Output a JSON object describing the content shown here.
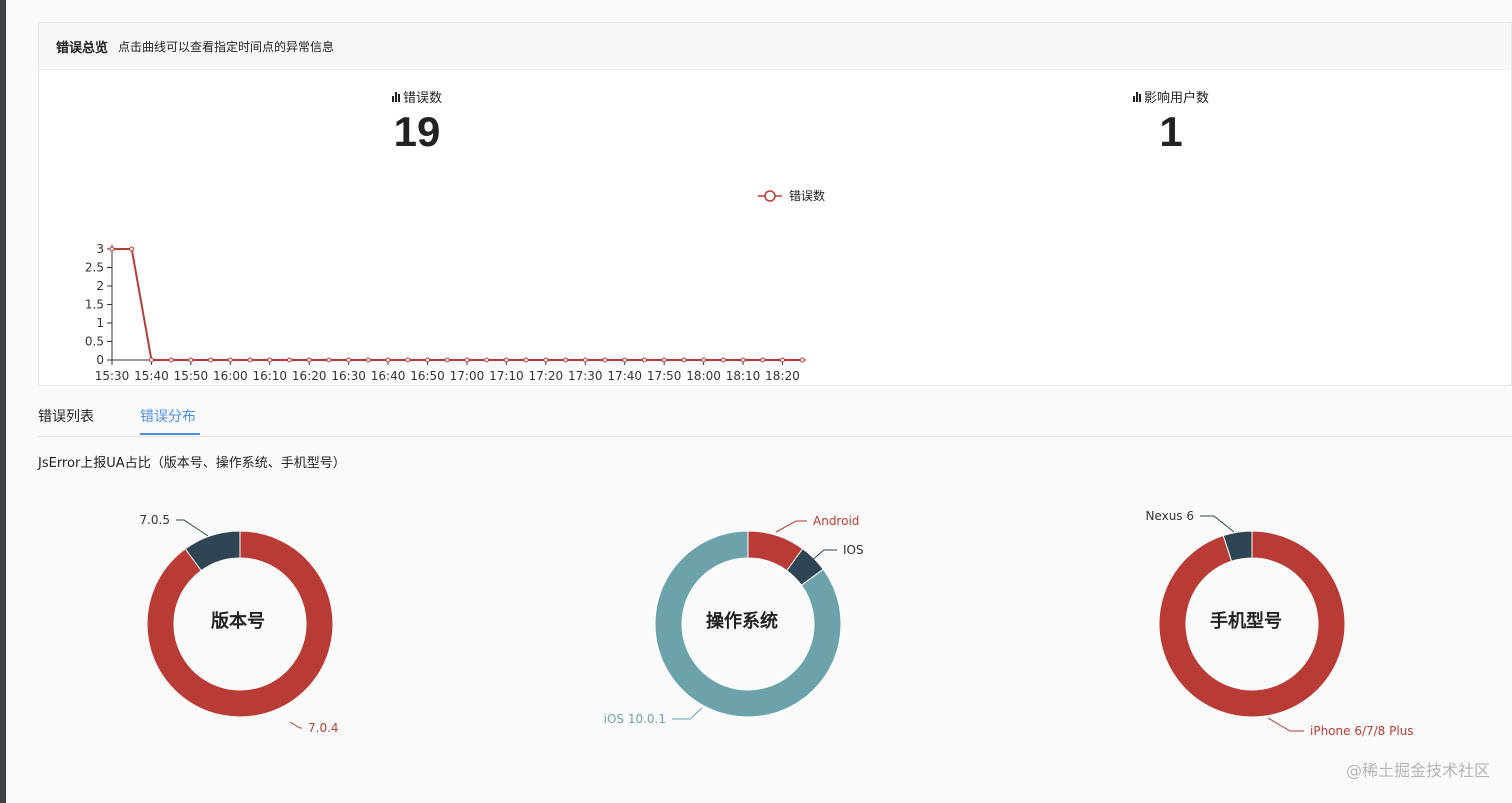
{
  "overview": {
    "title": "错误总览",
    "hint": "点击曲线可以查看指定时间点的异常信息",
    "stats": [
      {
        "label": "错误数",
        "value": "19"
      },
      {
        "label": "影响用户数",
        "value": "1"
      }
    ]
  },
  "colors": {
    "red": "#b83b35",
    "dark": "#2f4554",
    "teal": "#6ca3aa",
    "tab_active": "#4a90e2"
  },
  "chart_data": [
    {
      "type": "line",
      "legend": [
        "错误数"
      ],
      "x": [
        "15:30",
        "15:35",
        "15:40",
        "15:45",
        "15:50",
        "15:55",
        "16:00",
        "16:05",
        "16:10",
        "16:15",
        "16:20",
        "16:25",
        "16:30",
        "16:35",
        "16:40",
        "16:45",
        "16:50",
        "16:55",
        "17:00",
        "17:05",
        "17:10",
        "17:15",
        "17:20",
        "17:25",
        "17:30",
        "17:35",
        "17:40",
        "17:45",
        "17:50",
        "17:55",
        "18:00",
        "18:05",
        "18:10",
        "18:15",
        "18:20",
        "18:25"
      ],
      "x_tick_labels": [
        "15:30",
        "15:40",
        "15:50",
        "16:00",
        "16:10",
        "16:20",
        "16:30",
        "16:40",
        "16:50",
        "17:00",
        "17:10",
        "17:20",
        "17:30",
        "17:40",
        "17:50",
        "18:00",
        "18:10",
        "18:20"
      ],
      "y_tick_labels": [
        "0",
        "0.5",
        "1",
        "1.5",
        "2",
        "2.5",
        "3"
      ],
      "series": [
        {
          "name": "错误数",
          "values": [
            3,
            3,
            0,
            0,
            0,
            0,
            0,
            0,
            0,
            0,
            0,
            0,
            0,
            0,
            0,
            0,
            0,
            0,
            0,
            0,
            0,
            0,
            0,
            0,
            0,
            0,
            0,
            0,
            0,
            0,
            0,
            0,
            0,
            0,
            0,
            0
          ]
        }
      ],
      "ylim": [
        0,
        3
      ]
    },
    {
      "type": "pie",
      "title": "版本号",
      "slices": [
        {
          "label": "7.0.4",
          "value": 0.9,
          "color": "#b83b35"
        },
        {
          "label": "7.0.5",
          "value": 0.1,
          "color": "#2f4554"
        }
      ]
    },
    {
      "type": "pie",
      "title": "操作系统",
      "slices": [
        {
          "label": "Android",
          "value": 0.1,
          "color": "#b83b35"
        },
        {
          "label": "IOS",
          "value": 0.05,
          "color": "#2f4554"
        },
        {
          "label": "iOS 10.0.1",
          "value": 0.85,
          "color": "#6ca3aa"
        }
      ]
    },
    {
      "type": "pie",
      "title": "手机型号",
      "slices": [
        {
          "label": "iPhone 6/7/8 Plus",
          "value": 0.95,
          "color": "#b83b35"
        },
        {
          "label": "Nexus 6",
          "value": 0.05,
          "color": "#2f4554"
        }
      ]
    }
  ],
  "tabs": [
    {
      "label": "错误列表",
      "active": false
    },
    {
      "label": "错误分布",
      "active": true
    }
  ],
  "distribution": {
    "title": "JsError上报UA占比（版本号、操作系统、手机型号）"
  },
  "watermark": "@稀土掘金技术社区"
}
